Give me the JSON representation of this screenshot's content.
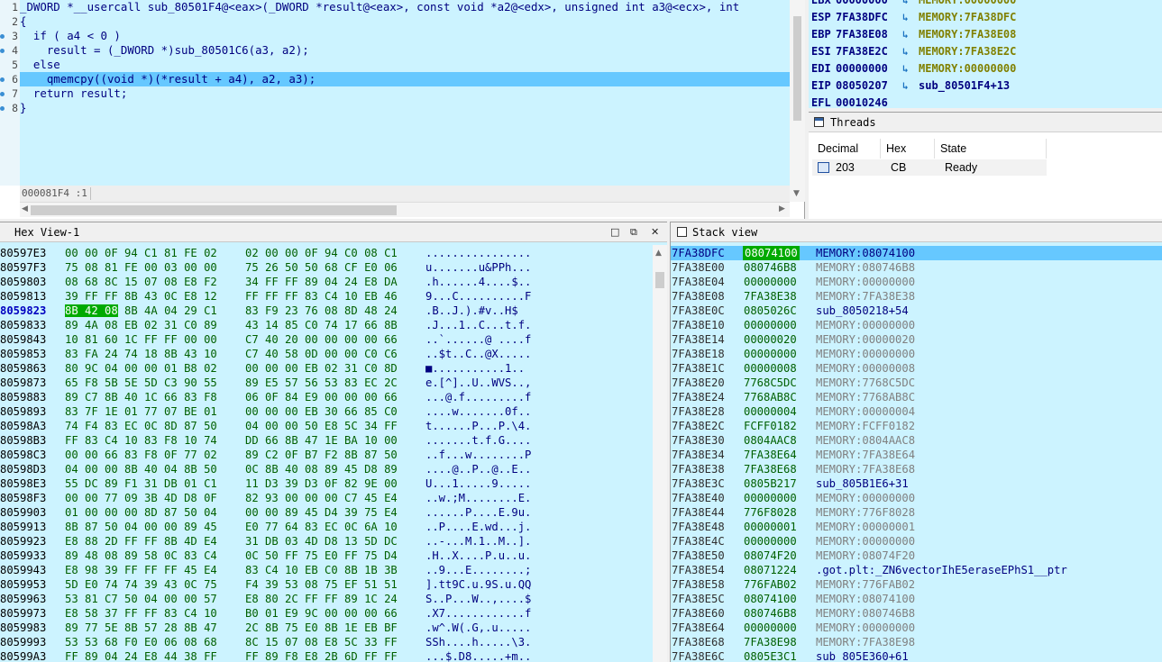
{
  "code": {
    "lines": [
      {
        "num": "1",
        "text": "_DWORD *__usercall sub_80501F4@<eax>(_DWORD *result@<eax>, const void *a2@<edx>, unsigned int a3@<ecx>, int",
        "dot": false
      },
      {
        "num": "2",
        "text": "{",
        "dot": false
      },
      {
        "num": "3",
        "text": "  if ( a4 < 0 )",
        "dot": true
      },
      {
        "num": "4",
        "text": "    result = (_DWORD *)sub_80501C6(a3, a2);",
        "dot": true
      },
      {
        "num": "5",
        "text": "  else",
        "dot": false
      },
      {
        "num": "6",
        "text": "    qmemcpy((void *)(*result + a4), a2, a3);",
        "dot": true
      },
      {
        "num": "7",
        "text": "  return result;",
        "dot": true
      },
      {
        "num": "8",
        "text": "}",
        "dot": true
      }
    ],
    "highlighted_line": "6",
    "status": "000081F4 :1"
  },
  "registers": [
    {
      "name": "EBX",
      "value": "00000000",
      "target": "MEMORY:00000000",
      "is_code": false
    },
    {
      "name": "ESP",
      "value": "7FA38DFC",
      "target": "MEMORY:7FA38DFC",
      "is_code": false
    },
    {
      "name": "EBP",
      "value": "7FA38E08",
      "target": "MEMORY:7FA38E08",
      "is_code": false
    },
    {
      "name": "ESI",
      "value": "7FA38E2C",
      "target": "MEMORY:7FA38E2C",
      "is_code": false
    },
    {
      "name": "EDI",
      "value": "00000000",
      "target": "MEMORY:00000000",
      "is_code": false
    },
    {
      "name": "EIP",
      "value": "08050207",
      "target": "sub_80501F4+13",
      "is_code": true
    },
    {
      "name": "EFL",
      "value": "00010246",
      "target": "",
      "is_code": false
    }
  ],
  "threads": {
    "title": "Threads",
    "columns": [
      "Decimal",
      "Hex",
      "State"
    ],
    "rows": [
      {
        "decimal": "203",
        "hex": "CB",
        "state": "Ready"
      }
    ]
  },
  "hex_view": {
    "title": "Hex View-1",
    "current_addr": "8059823",
    "selected_bytes": "8B 42 08",
    "rows": [
      {
        "addr": "80597E3",
        "b1": "00 00 0F 94 C1 81 FE 02",
        "b2": "02 00 00 0F 94 C0 08 C1",
        "ascii": "................"
      },
      {
        "addr": "80597F3",
        "b1": "75 08 81 FE 00 03 00 00",
        "b2": "75 26 50 50 68 CF E0 06",
        "ascii": "u.......u&PPh..."
      },
      {
        "addr": "8059803",
        "b1": "08 68 8C 15 07 08 E8 F2",
        "b2": "34 FF FF 89 04 24 E8 DA",
        "ascii": ".h......4....$.."
      },
      {
        "addr": "8059813",
        "b1": "39 FF FF 8B 43 0C E8 12",
        "b2": "FF FF FF 83 C4 10 EB 46",
        "ascii": "9...C..........F"
      },
      {
        "addr": "8059823",
        "b1": "8B 42 08 8B 4A 04 29 C1",
        "b2": "83 F9 23 76 08 8D 48 24",
        "ascii": ".B..J.).#v..H$"
      },
      {
        "addr": "8059833",
        "b1": "89 4A 08 EB 02 31 C0 89",
        "b2": "43 14 85 C0 74 17 66 8B",
        "ascii": ".J...1..C...t.f."
      },
      {
        "addr": "8059843",
        "b1": "10 81 60 1C FF FF 00 00",
        "b2": "C7 40 20 00 00 00 00 66",
        "ascii": "..`......@ ....f"
      },
      {
        "addr": "8059853",
        "b1": "83 FA 24 74 18 8B 43 10",
        "b2": "C7 40 58 0D 00 00 C0 C6",
        "ascii": "..$t..C..@X....."
      },
      {
        "addr": "8059863",
        "b1": "80 9C 04 00 00 01 B8 02",
        "b2": "00 00 00 EB 02 31 C0 8D",
        "ascii": "■...........1.."
      },
      {
        "addr": "8059873",
        "b1": "65 F8 5B 5E 5D C3 90 55",
        "b2": "89 E5 57 56 53 83 EC 2C",
        "ascii": "e.[^]..U..WVS..,"
      },
      {
        "addr": "8059883",
        "b1": "89 C7 8B 40 1C 66 83 F8",
        "b2": "06 0F 84 E9 00 00 00 66",
        "ascii": "...@.f.........f"
      },
      {
        "addr": "8059893",
        "b1": "83 7F 1E 01 77 07 BE 01",
        "b2": "00 00 00 EB 30 66 85 C0",
        "ascii": "....w.......0f.."
      },
      {
        "addr": "80598A3",
        "b1": "74 F4 83 EC 0C 8D 87 50",
        "b2": "04 00 00 50 E8 5C 34 FF",
        "ascii": "t......P...P.\\4."
      },
      {
        "addr": "80598B3",
        "b1": "FF 83 C4 10 83 F8 10 74",
        "b2": "DD 66 8B 47 1E BA 10 00",
        "ascii": ".......t.f.G...."
      },
      {
        "addr": "80598C3",
        "b1": "00 00 66 83 F8 0F 77 02",
        "b2": "89 C2 0F B7 F2 8B 87 50",
        "ascii": "..f...w........P"
      },
      {
        "addr": "80598D3",
        "b1": "04 00 00 8B 40 04 8B 50",
        "b2": "0C 8B 40 08 89 45 D8 89",
        "ascii": "....@..P..@..E.."
      },
      {
        "addr": "80598E3",
        "b1": "55 DC 89 F1 31 DB 01 C1",
        "b2": "11 D3 39 D3 0F 82 9E 00",
        "ascii": "U...1.....9....."
      },
      {
        "addr": "80598F3",
        "b1": "00 00 77 09 3B 4D D8 0F",
        "b2": "82 93 00 00 00 C7 45 E4",
        "ascii": "..w.;M........E."
      },
      {
        "addr": "8059903",
        "b1": "01 00 00 00 8D 87 50 04",
        "b2": "00 00 89 45 D4 39 75 E4",
        "ascii": "......P....E.9u."
      },
      {
        "addr": "8059913",
        "b1": "8B 87 50 04 00 00 89 45",
        "b2": "E0 77 64 83 EC 0C 6A 10",
        "ascii": "..P....E.wd...j."
      },
      {
        "addr": "8059923",
        "b1": "E8 88 2D FF FF 8B 4D E4",
        "b2": "31 DB 03 4D D8 13 5D DC",
        "ascii": "..-...M.1..M..]."
      },
      {
        "addr": "8059933",
        "b1": "89 48 08 89 58 0C 83 C4",
        "b2": "0C 50 FF 75 E0 FF 75 D4",
        "ascii": ".H..X....P.u..u."
      },
      {
        "addr": "8059943",
        "b1": "E8 98 39 FF FF FF 45 E4",
        "b2": "83 C4 10 EB C0 8B 1B 3B",
        "ascii": "..9...E........;"
      },
      {
        "addr": "8059953",
        "b1": "5D E0 74 74 39 43 0C 75",
        "b2": "F4 39 53 08 75 EF 51 51",
        "ascii": "].tt9C.u.9S.u.QQ"
      },
      {
        "addr": "8059963",
        "b1": "53 81 C7 50 04 00 00 57",
        "b2": "E8 80 2C FF FF 89 1C 24",
        "ascii": "S..P...W..,....$"
      },
      {
        "addr": "8059973",
        "b1": "E8 58 37 FF FF 83 C4 10",
        "b2": "B0 01 E9 9C 00 00 00 66",
        "ascii": ".X7............f"
      },
      {
        "addr": "8059983",
        "b1": "89 77 5E 8B 57 28 8B 47",
        "b2": "2C 8B 75 E0 8B 1E EB BF",
        "ascii": ".w^.W(.G,.u....."
      },
      {
        "addr": "8059993",
        "b1": "53 53 68 F0 E0 06 08 68",
        "b2": "8C 15 07 08 E8 5C 33 FF",
        "ascii": "SSh....h.....\\3."
      },
      {
        "addr": "80599A3",
        "b1": "FF 89 04 24 E8 44 38 FF",
        "b2": "FF 89 F8 E8 2B 6D FF FF",
        "ascii": "...$.D8.....+m.."
      }
    ]
  },
  "stack_view": {
    "title": "Stack view",
    "rows": [
      {
        "addr": "7FA38DFC",
        "val": "08074100",
        "desc": "MEMORY:08074100",
        "code": false,
        "cur": true
      },
      {
        "addr": "7FA38E00",
        "val": "080746B8",
        "desc": "MEMORY:080746B8",
        "code": false,
        "cur": false
      },
      {
        "addr": "7FA38E04",
        "val": "00000000",
        "desc": "MEMORY:00000000",
        "code": false,
        "cur": false
      },
      {
        "addr": "7FA38E08",
        "val": "7FA38E38",
        "desc": "MEMORY:7FA38E38",
        "code": false,
        "cur": false
      },
      {
        "addr": "7FA38E0C",
        "val": "0805026C",
        "desc": "sub_8050218+54",
        "code": true,
        "cur": false
      },
      {
        "addr": "7FA38E10",
        "val": "00000000",
        "desc": "MEMORY:00000000",
        "code": false,
        "cur": false
      },
      {
        "addr": "7FA38E14",
        "val": "00000020",
        "desc": "MEMORY:00000020",
        "code": false,
        "cur": false
      },
      {
        "addr": "7FA38E18",
        "val": "00000000",
        "desc": "MEMORY:00000000",
        "code": false,
        "cur": false
      },
      {
        "addr": "7FA38E1C",
        "val": "00000008",
        "desc": "MEMORY:00000008",
        "code": false,
        "cur": false
      },
      {
        "addr": "7FA38E20",
        "val": "7768C5DC",
        "desc": "MEMORY:7768C5DC",
        "code": false,
        "cur": false
      },
      {
        "addr": "7FA38E24",
        "val": "7768AB8C",
        "desc": "MEMORY:7768AB8C",
        "code": false,
        "cur": false
      },
      {
        "addr": "7FA38E28",
        "val": "00000004",
        "desc": "MEMORY:00000004",
        "code": false,
        "cur": false
      },
      {
        "addr": "7FA38E2C",
        "val": "FCFF0182",
        "desc": "MEMORY:FCFF0182",
        "code": false,
        "cur": false
      },
      {
        "addr": "7FA38E30",
        "val": "0804AAC8",
        "desc": "MEMORY:0804AAC8",
        "code": false,
        "cur": false
      },
      {
        "addr": "7FA38E34",
        "val": "7FA38E64",
        "desc": "MEMORY:7FA38E64",
        "code": false,
        "cur": false
      },
      {
        "addr": "7FA38E38",
        "val": "7FA38E68",
        "desc": "MEMORY:7FA38E68",
        "code": false,
        "cur": false
      },
      {
        "addr": "7FA38E3C",
        "val": "0805B217",
        "desc": "sub_805B1E6+31",
        "code": true,
        "cur": false
      },
      {
        "addr": "7FA38E40",
        "val": "00000000",
        "desc": "MEMORY:00000000",
        "code": false,
        "cur": false
      },
      {
        "addr": "7FA38E44",
        "val": "776F8028",
        "desc": "MEMORY:776F8028",
        "code": false,
        "cur": false
      },
      {
        "addr": "7FA38E48",
        "val": "00000001",
        "desc": "MEMORY:00000001",
        "code": false,
        "cur": false
      },
      {
        "addr": "7FA38E4C",
        "val": "00000000",
        "desc": "MEMORY:00000000",
        "code": false,
        "cur": false
      },
      {
        "addr": "7FA38E50",
        "val": "08074F20",
        "desc": "MEMORY:08074F20",
        "code": false,
        "cur": false
      },
      {
        "addr": "7FA38E54",
        "val": "08071224",
        "desc": ".got.plt:_ZN6vectorIhE5eraseEPhS1__ptr",
        "code": true,
        "cur": false
      },
      {
        "addr": "7FA38E58",
        "val": "776FAB02",
        "desc": "MEMORY:776FAB02",
        "code": false,
        "cur": false
      },
      {
        "addr": "7FA38E5C",
        "val": "08074100",
        "desc": "MEMORY:08074100",
        "code": false,
        "cur": false
      },
      {
        "addr": "7FA38E60",
        "val": "080746B8",
        "desc": "MEMORY:080746B8",
        "code": false,
        "cur": false
      },
      {
        "addr": "7FA38E64",
        "val": "00000000",
        "desc": "MEMORY:00000000",
        "code": false,
        "cur": false
      },
      {
        "addr": "7FA38E68",
        "val": "7FA38E98",
        "desc": "MEMORY:7FA38E98",
        "code": false,
        "cur": false
      },
      {
        "addr": "7FA38E6C",
        "val": "0805E3C1",
        "desc": "sub_805E360+61",
        "code": true,
        "cur": false
      }
    ]
  }
}
